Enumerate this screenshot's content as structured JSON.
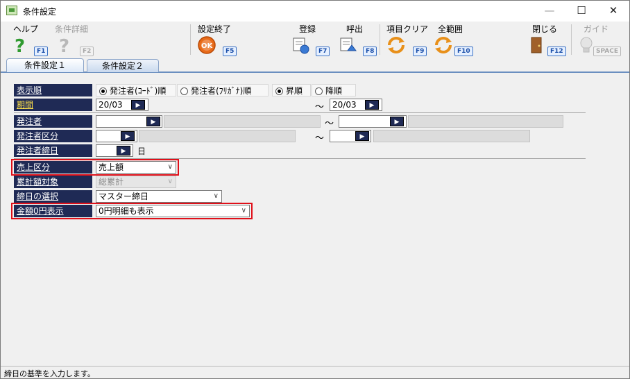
{
  "window": {
    "title": "条件設定",
    "min": "—",
    "max": "☐",
    "close": "✕"
  },
  "toolbar": {
    "help": {
      "label": "ヘルプ",
      "key": "F1"
    },
    "detail": {
      "label": "条件詳細",
      "key": "F2"
    },
    "finish": {
      "label": "設定終了",
      "key": "F5",
      "icon_text": "OK"
    },
    "register": {
      "label": "登録",
      "key": "F7"
    },
    "recall": {
      "label": "呼出",
      "key": "F8"
    },
    "clear": {
      "label": "項目クリア",
      "key": "F9"
    },
    "full_range": {
      "label": "全範囲",
      "key": "F10"
    },
    "close": {
      "label": "閉じる",
      "key": "F12"
    },
    "guide": {
      "label": "ガイド",
      "key": "SPACE"
    }
  },
  "tabs": [
    {
      "label": "条件設定１"
    },
    {
      "label": "条件設定２"
    }
  ],
  "form": {
    "sort_order": {
      "label": "表示順",
      "opt_code": "発注者(ｺｰﾄﾞ)順",
      "opt_kana": "発注者(ﾌﾘｶﾞﾅ)順",
      "opt_asc": "昇順",
      "opt_desc": "降順"
    },
    "period": {
      "label": "期間",
      "from": "20/03",
      "to": "20/03"
    },
    "orderer": {
      "label": "発注者"
    },
    "orderer_category": {
      "label": "発注者区分"
    },
    "orderer_closing": {
      "label": "発注者締日",
      "suffix": "日"
    },
    "sales_category": {
      "label": "売上区分",
      "value": "売上額"
    },
    "cumulative_target": {
      "label": "累計額対象",
      "value": "総累計"
    },
    "closing_selection": {
      "label": "締日の選択",
      "value": "マスター締日"
    },
    "zero_amount": {
      "label": "金額0円表示",
      "value": "0円明細も表示"
    },
    "tilde": "～",
    "arrow": "▶",
    "dropdown": "∨"
  },
  "status": {
    "text": "締日の基準を入力します。"
  },
  "colors": {
    "label_bg": "#1f2a55",
    "highlight": "#e0101a",
    "period_label": "#ffe24a"
  }
}
